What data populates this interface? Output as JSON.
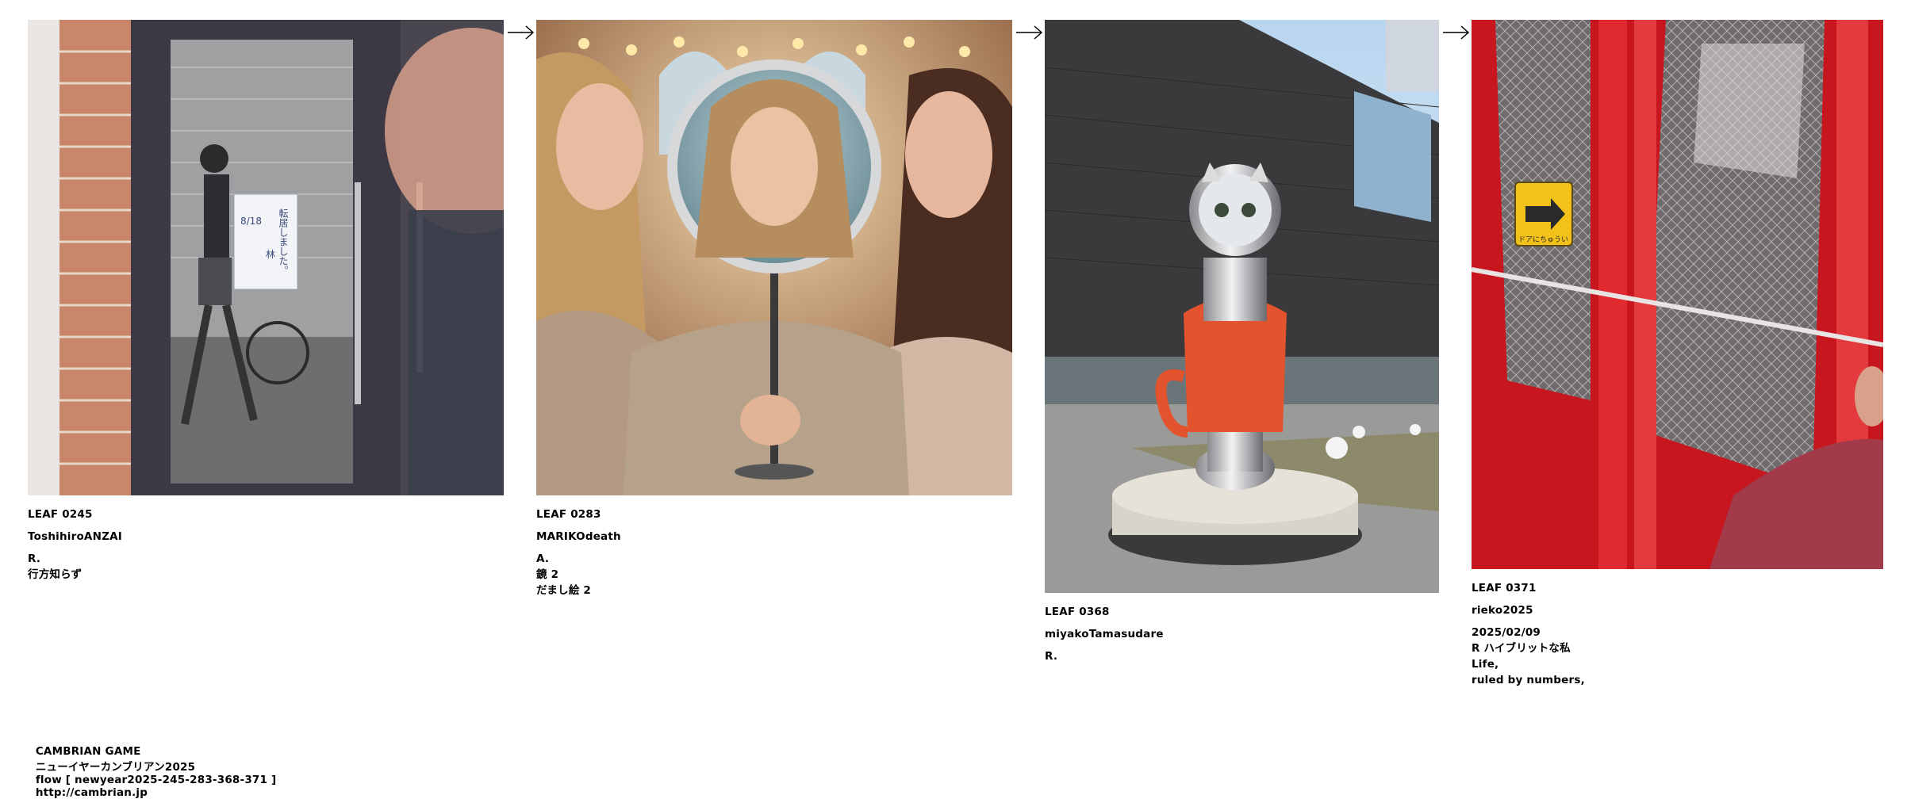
{
  "leaves": [
    {
      "id": "LEAF 0245",
      "author": "ToshihiroANZAI",
      "lines": [
        "R.",
        "行方知らず"
      ],
      "notice_text": "転居しました。",
      "notice_date": "8/18",
      "notice_name": "林"
    },
    {
      "id": "LEAF 0283",
      "author": "MARIKOdeath",
      "lines": [
        "A.",
        "鏡 2",
        "だまし絵 2"
      ]
    },
    {
      "id": "LEAF 0368",
      "author": "miyakoTamasudare",
      "lines": [
        "R."
      ]
    },
    {
      "id": "LEAF 0371",
      "author": "rieko2025",
      "lines": [
        "2025/02/09",
        "R ハイブリットな私",
        "Life,",
        "ruled by numbers,"
      ],
      "sign_text": "ドアにちゅうい"
    }
  ],
  "footer": {
    "game": "CAMBRIAN GAME",
    "title": "ニューイヤーカンブリアン2025",
    "flow": "flow [ newyear2025-245-283-368-371 ]",
    "url": "http://cambrian.jp"
  }
}
